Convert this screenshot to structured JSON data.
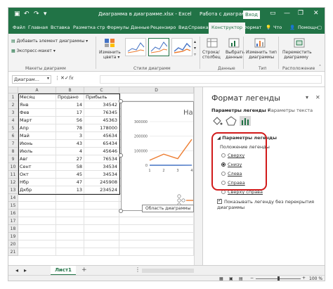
{
  "app": {
    "doc_title": "Диаграмма в диаграмме.xlsx - Excel",
    "context_title": "Работа с диаграммами",
    "signin": "Вход",
    "qa_icons": [
      "save-icon",
      "undo-icon",
      "redo-icon",
      "customize-icon"
    ],
    "window_controls": [
      "ribbon-options-icon",
      "minimize-icon",
      "restore-icon",
      "close-icon"
    ],
    "accent": "#217346"
  },
  "tabs": [
    {
      "label": "Файл"
    },
    {
      "label": "Главная"
    },
    {
      "label": "Вставка"
    },
    {
      "label": "Разметка стр"
    },
    {
      "label": "Формулы"
    },
    {
      "label": "Данные"
    },
    {
      "label": "Рецензиро"
    },
    {
      "label": "Вид"
    },
    {
      "label": "Справка"
    },
    {
      "label": "Конструктор"
    },
    {
      "label": "Формат"
    },
    {
      "label": "Что"
    },
    {
      "label": "Помощн"
    }
  ],
  "ribbon": {
    "add_element": "Добавить элемент диаграммы",
    "express_layout": "Экспресс-макет",
    "group_layouts": "Макеты диаграмм",
    "change_colors_1": "Изменить",
    "change_colors_2": "цвета",
    "group_styles": "Стили диаграмм",
    "row_col_1": "Строка/",
    "row_col_2": "столбец",
    "select_data_1": "Выбрать",
    "select_data_2": "данные",
    "group_data": "Данные",
    "change_type_1": "Изменить тип",
    "change_type_2": "диаграммы",
    "group_type": "Тип",
    "move_chart_1": "Переместить",
    "move_chart_2": "диаграмму",
    "group_location": "Расположение"
  },
  "formula_bar": {
    "name_box": "Диаграм...",
    "fx": "fx",
    "value": ""
  },
  "grid": {
    "columns": [
      "A",
      "B",
      "C",
      "D"
    ],
    "header": [
      "Месяц",
      "Продано",
      "Прибыль"
    ],
    "rows": [
      [
        "Янв",
        "14",
        "34542"
      ],
      [
        "Фев",
        "17",
        "76345"
      ],
      [
        "Март",
        "56",
        "45363"
      ],
      [
        "Апр",
        "78",
        "178000"
      ],
      [
        "Май",
        "3",
        "45634"
      ],
      [
        "Июнь",
        "43",
        "65434"
      ],
      [
        "Июль",
        "4",
        "45646"
      ],
      [
        "Авг",
        "27",
        "76534"
      ],
      [
        "Сент",
        "58",
        "34534"
      ],
      [
        "Окт",
        "45",
        "34534"
      ],
      [
        "Нбр",
        "47",
        "245908"
      ],
      [
        "Дкбр",
        "13",
        "234524"
      ]
    ],
    "row_numbers": [
      "1",
      "2",
      "3",
      "4",
      "5",
      "6",
      "7",
      "8",
      "9",
      "10",
      "11",
      "12",
      "13",
      "14",
      "15",
      "16",
      "17",
      "18",
      "19",
      "20",
      "21"
    ]
  },
  "chart": {
    "title": "Назв",
    "tooltip": "Область диаграммы",
    "y_ticks": [
      "0",
      "100000",
      "200000",
      "300000"
    ],
    "x_ticks": [
      "1",
      "2",
      "3",
      "4"
    ],
    "series_colors": [
      "#4472c4",
      "#ed7d31"
    ],
    "legend_entry": ""
  },
  "chart_data": {
    "type": "line",
    "title": "Назв",
    "x": [
      1,
      2,
      3,
      4
    ],
    "series": [
      {
        "values": [
          14,
          17,
          56,
          78
        ],
        "color": "#4472c4"
      },
      {
        "values": [
          34542,
          76345,
          45363,
          178000
        ],
        "color": "#ed7d31"
      }
    ],
    "ylim": [
      0,
      300000
    ]
  },
  "sheet": {
    "tab": "Лист1",
    "add": "+"
  },
  "status": {
    "zoom": "100 %",
    "zoom_minus": "−",
    "zoom_plus": "+"
  },
  "pane": {
    "title": "Формат легенды",
    "tab_params": "Параметры легенды",
    "tab_text": "Параметры текста",
    "section": "Параметры легенды",
    "position_label": "Положение легенды",
    "options": [
      {
        "label": "Сверху",
        "checked": false
      },
      {
        "label": "Снизу",
        "checked": true
      },
      {
        "label": "Слева",
        "checked": false
      },
      {
        "label": "Справа",
        "checked": false
      },
      {
        "label": "Сверху справа",
        "checked": false
      }
    ],
    "overlap_label": "Показывать легенду без перекрытия диаграммы"
  }
}
